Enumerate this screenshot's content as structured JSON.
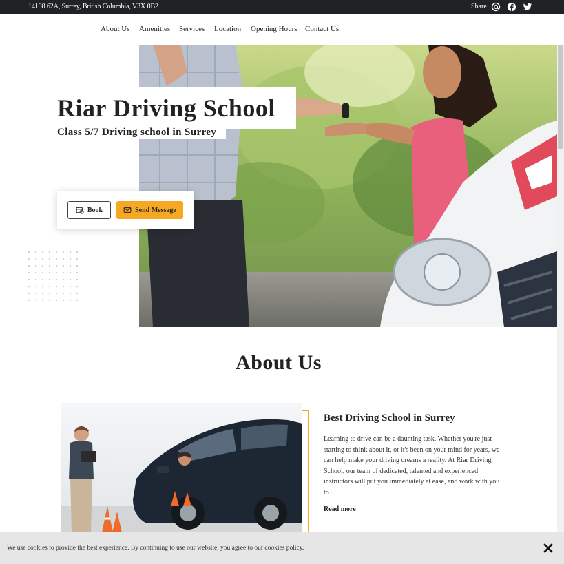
{
  "topbar": {
    "address": "14198 62A, Surrey, British Columbia, V3X 0B2",
    "share_label": "Share",
    "icons": [
      "email-at-icon",
      "facebook-icon",
      "twitter-icon"
    ]
  },
  "nav": {
    "items": [
      "About Us",
      "Amenities",
      "Services",
      "Location",
      "Opening Hours",
      "Contact Us"
    ]
  },
  "hero": {
    "title": "Riar Driving School",
    "subtitle": "Class 5/7 Driving school in Surrey",
    "book_label": "Book",
    "message_label": "Send Message"
  },
  "about": {
    "section_title": "About Us",
    "heading": "Best Driving School in Surrey",
    "text": "Learning to drive can be a daunting task. Whether you're just starting to think about it, or it's been on your mind for years, we can help make your driving dreams a reality. At Riar Driving School, our team of dedicated, talented and experienced instructors will put you immediately at ease, and work with you to ...",
    "read_more": "Read more"
  },
  "cookie": {
    "message": "We use cookies to provide the best experience. By continuing to use our website, you agree to our cookies policy."
  },
  "colors": {
    "accent": "#f7a823",
    "topbar_bg": "#1f2326",
    "cookie_bg": "#e6e6e6"
  }
}
